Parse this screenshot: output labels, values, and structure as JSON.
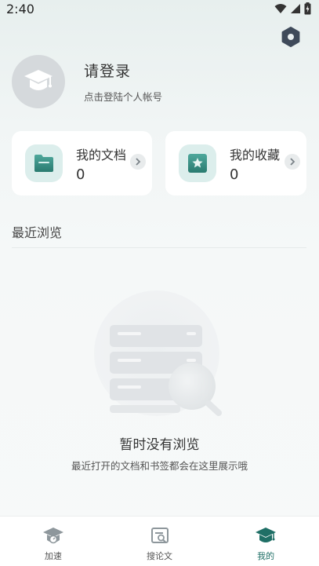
{
  "status_bar": {
    "time": "2:40"
  },
  "profile": {
    "title": "请登录",
    "subtitle": "点击登陆个人帐号"
  },
  "cards": {
    "docs": {
      "title": "我的文档",
      "count": "0"
    },
    "favorites": {
      "title": "我的收藏",
      "count": "0"
    }
  },
  "recent": {
    "title": "最近浏览",
    "empty_title": "暂时没有浏览",
    "empty_desc": "最近打开的文档和书签都会在这里展示哦"
  },
  "tabbar": {
    "items": [
      {
        "label": "加速",
        "icon": "graduation-cap-speed-icon",
        "active": false
      },
      {
        "label": "搜论文",
        "icon": "search-paper-icon",
        "active": false
      },
      {
        "label": "我的",
        "icon": "graduation-cap-icon",
        "active": true
      }
    ]
  },
  "colors": {
    "accent": "#1f6f66",
    "avatar_bg": "#d5d9dc",
    "card_icon_bg": "#dceeec",
    "settings_icon": "#3f4a5a"
  }
}
